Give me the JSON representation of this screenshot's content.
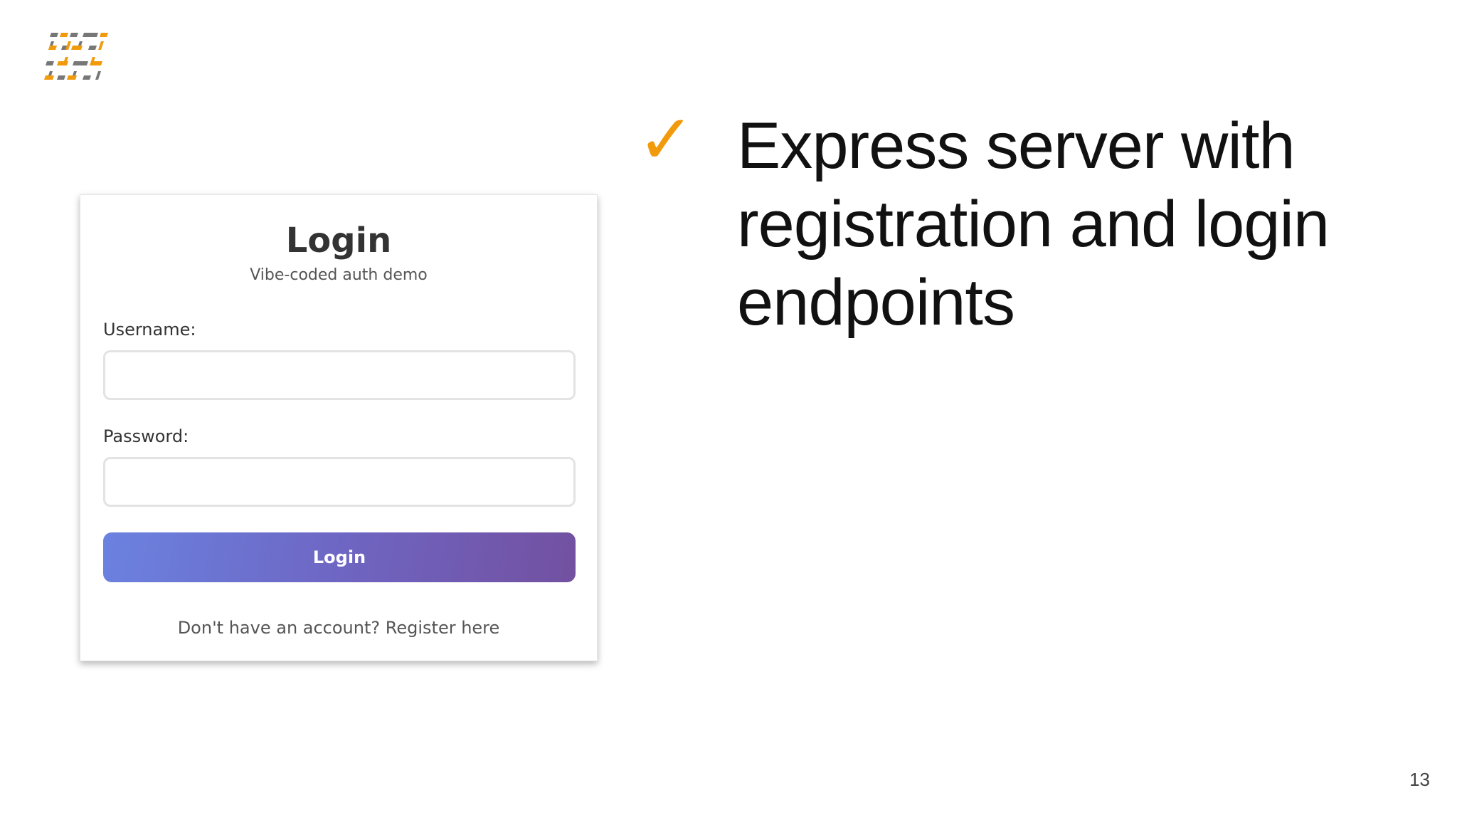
{
  "logo": {
    "icon": "brand-grid-logo",
    "colors": {
      "orange": "#f19a0b",
      "gray": "#777777"
    }
  },
  "login_card": {
    "title": "Login",
    "subtitle": "Vibe-coded auth demo",
    "username_label": "Username:",
    "username_value": "",
    "password_label": "Password:",
    "password_value": "",
    "button_label": "Login",
    "register_prompt": "Don't have an account? Register here",
    "button_gradient": [
      "#6b82e0",
      "#7350a0"
    ]
  },
  "bullet": {
    "icon": "checkmark-icon",
    "mark": "✓",
    "text": "Express server with registration and login endpoints",
    "accent": "#f19a0b"
  },
  "page_number": "13"
}
